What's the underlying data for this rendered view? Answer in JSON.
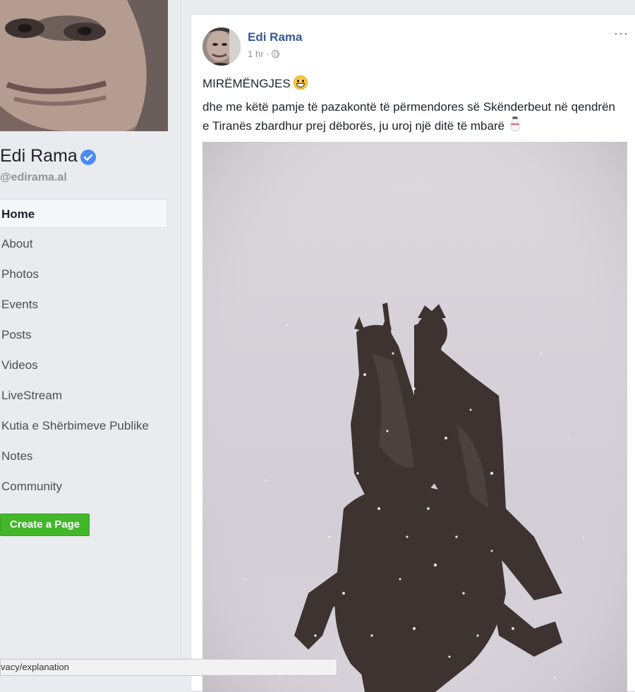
{
  "profile": {
    "name": "Edi Rama",
    "handle": "@edirama.al"
  },
  "nav": {
    "items": [
      {
        "label": "Home",
        "active": true
      },
      {
        "label": "About"
      },
      {
        "label": "Photos"
      },
      {
        "label": "Events"
      },
      {
        "label": "Posts"
      },
      {
        "label": "Videos"
      },
      {
        "label": "LiveStream"
      },
      {
        "label": "Kutia e Shërbimeve Publike"
      },
      {
        "label": "Notes"
      },
      {
        "label": "Community"
      }
    ],
    "create_page_label": "Create a Page"
  },
  "post": {
    "author": "Edi Rama",
    "time": "1 hr ·",
    "line1": "MIRËMËNGJES",
    "line2": "dhe me këtë pamje të pazakontë të përmendores së Skënderbeut në qendrën e Tiranës zbardhur prej dëborës, ju uroj një ditë të mbarë",
    "more_label": "···"
  },
  "status_bar": {
    "text": "vacy/explanation"
  },
  "colors": {
    "link": "#365899",
    "accent_green": "#42b72a",
    "verified": "#4c8bf5",
    "background": "#e9ebee"
  },
  "icons": [
    "verified-badge-icon",
    "globe-icon",
    "more-options-icon",
    "grinning-face-emoji",
    "snowman-emoji"
  ]
}
